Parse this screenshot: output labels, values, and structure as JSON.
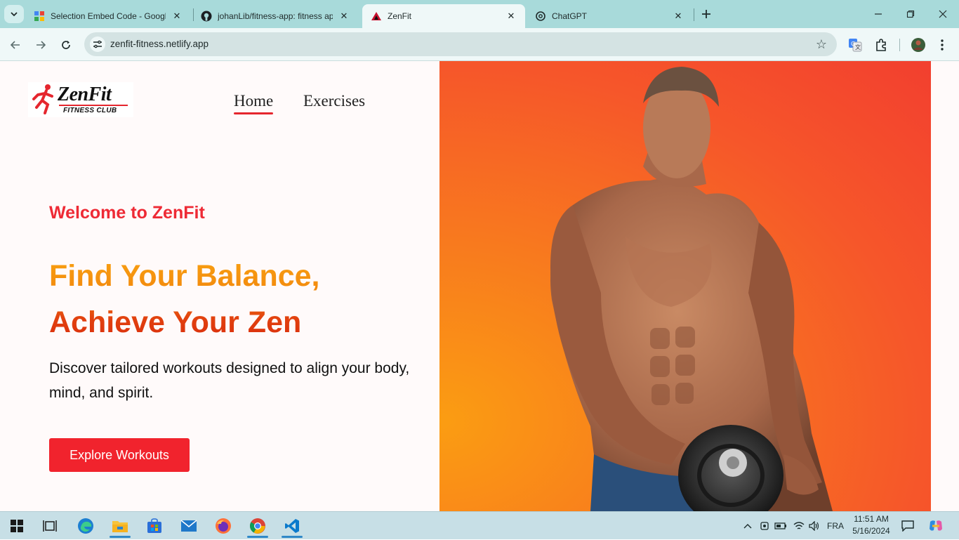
{
  "browser": {
    "tabs": [
      {
        "title": "Selection Embed Code - Google",
        "icon": "google-sites-icon",
        "active": false
      },
      {
        "title": "johanLib/fitness-app: fitness ap",
        "icon": "github-icon",
        "active": false
      },
      {
        "title": "ZenFit",
        "icon": "zenfit-favicon",
        "active": true
      },
      {
        "title": "ChatGPT",
        "icon": "chatgpt-icon",
        "active": false
      }
    ],
    "url": "zenfit-fitness.netlify.app",
    "accent": "#a8dada"
  },
  "site": {
    "logo": {
      "name": "ZenFit",
      "tagline": "FITNESS CLUB"
    },
    "nav": [
      {
        "label": "Home",
        "active": true
      },
      {
        "label": "Exercises",
        "active": false
      }
    ],
    "hero": {
      "welcome": "Welcome to ZenFit",
      "headline_line1": "Find Your Balance,",
      "headline_line2": "Achieve Your Zen",
      "description": "Discover tailored workouts designed to align your body, mind, and spirit.",
      "cta_label": "Explore Workouts",
      "image": "muscular-man-with-dumbbell"
    },
    "colors": {
      "primary": "#f1232d",
      "orange": "#f9a412",
      "hero_bg": "#f6562a"
    }
  },
  "taskbar": {
    "apps": [
      "start-icon",
      "task-view-icon",
      "edge-icon",
      "file-explorer-icon",
      "store-icon",
      "mail-icon",
      "firefox-icon",
      "chrome-icon",
      "vscode-icon"
    ],
    "language": "FRA",
    "time": "11:51 AM",
    "date": "5/16/2024"
  }
}
